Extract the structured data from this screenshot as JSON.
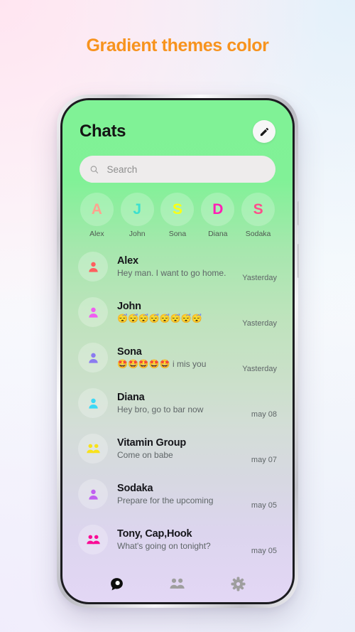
{
  "headline": "Gradient themes color",
  "app": {
    "title": "Chats",
    "edit_icon": "pencil-icon",
    "search": {
      "placeholder": "Search",
      "value": "",
      "icon": "search-icon"
    },
    "theme": {
      "gradient_top": "#80f296",
      "gradient_mid": "#cbe0ca",
      "gradient_bottom": "#e3d7f5",
      "headline_color": "#f7931e",
      "search_bg": "#eeecec"
    },
    "stories": [
      {
        "initial": "A",
        "name": "Alex",
        "color": "#ffa38f"
      },
      {
        "initial": "J",
        "name": "John",
        "color": "#3ce0cf"
      },
      {
        "initial": "S",
        "name": "Sona",
        "color": "#fbff12"
      },
      {
        "initial": "D",
        "name": "Diana",
        "color": "#ff1fb5"
      },
      {
        "initial": "S",
        "name": "Sodaka",
        "color": "#ff4f8b"
      }
    ],
    "chats": [
      {
        "name": "Alex",
        "preview": "Hey man. I want to go home.",
        "time": "Yasterday",
        "icon": "person-icon",
        "color": "#ff5f5f"
      },
      {
        "name": "John",
        "preview": "😴😴😴😴😴😴😴😴",
        "time": "Yasterday",
        "icon": "person-icon",
        "color": "#ef5ff0"
      },
      {
        "name": "Sona",
        "preview": "🤩🤩🤩🤩🤩 i mis you",
        "time": "Yasterday",
        "icon": "person-icon",
        "color": "#8b7bf0"
      },
      {
        "name": "Diana",
        "preview": "Hey bro, go to bar now",
        "time": "may 08",
        "icon": "person-icon",
        "color": "#3bd8f5"
      },
      {
        "name": "Vitamin Group",
        "preview": "Come on babe",
        "time": "may 07",
        "icon": "group-icon",
        "color": "#f8e21a"
      },
      {
        "name": "Sodaka",
        "preview": "Prepare for the upcoming",
        "time": "may 05",
        "icon": "person-icon",
        "color": "#c060f0"
      },
      {
        "name": "Tony, Cap,Hook",
        "preview": "What's going on tonight?",
        "time": "may 05",
        "icon": "group-icon",
        "color": "#fa0c96"
      }
    ],
    "bottom_nav": [
      {
        "icon": "chat-bubble-icon",
        "label": "Chats",
        "active": true,
        "color": "#0d0d0d"
      },
      {
        "icon": "people-icon",
        "label": "Contacts",
        "active": false,
        "color": "#9e9e9e"
      },
      {
        "icon": "gear-icon",
        "label": "Settings",
        "active": false,
        "color": "#9e9e9e"
      }
    ]
  }
}
